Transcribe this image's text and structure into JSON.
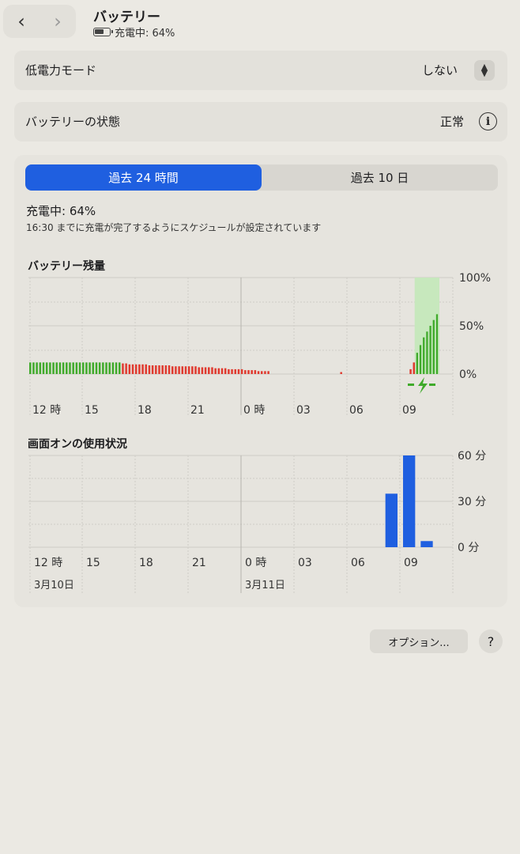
{
  "header": {
    "back_icon": "chevron-left-icon",
    "forward_icon": "chevron-right-icon",
    "title": "バッテリー",
    "subtitle": "充電中: 64%"
  },
  "low_power": {
    "label": "低電力モード",
    "value": "しない"
  },
  "battery_health": {
    "label": "バッテリーの状態",
    "value": "正常"
  },
  "tabs": [
    {
      "label": "過去 24 時間",
      "selected": true
    },
    {
      "label": "過去 10 日",
      "selected": false
    }
  ],
  "charge": {
    "status": "充電中: 64%",
    "schedule": "16:30 までに充電が完了するようにスケジュールが設定されています"
  },
  "battery_chart_title": "バッテリー残量",
  "screen_chart_title": "画面オンの使用状況",
  "x_ticks": [
    "12 時",
    "15",
    "18",
    "21",
    "0 時",
    "03",
    "06",
    "09"
  ],
  "date_labels": [
    "3月10日",
    "3月11日"
  ],
  "buttons": {
    "options": "オプション...",
    "help": "?"
  },
  "colors": {
    "accent": "#1f5fe0",
    "battery_green": "#3faa2a",
    "battery_red": "#e03a2f",
    "usage_blue": "#1f5fe0",
    "charging_band": "#c7e8bd"
  },
  "chart_data": [
    {
      "type": "bar",
      "title": "バッテリー残量",
      "xlabel": "",
      "ylabel": "",
      "y_ticks": [
        "100%",
        "50%",
        "0%"
      ],
      "ylim": [
        0,
        100
      ],
      "x_ticks": [
        "12 時",
        "15",
        "18",
        "21",
        "0 時",
        "03",
        "06",
        "09"
      ],
      "series": [
        {
          "values": [
            12,
            12,
            12,
            12,
            12,
            12,
            12,
            12,
            12,
            12,
            12,
            12,
            12,
            12,
            12,
            12,
            12,
            12,
            12,
            12,
            12,
            12,
            12,
            12,
            12,
            12,
            12,
            12,
            11,
            11,
            10,
            10,
            10,
            10,
            10,
            10,
            9,
            9,
            9,
            9,
            9,
            9,
            9,
            8,
            8,
            8,
            8,
            8,
            8,
            8,
            8,
            7,
            7,
            7,
            7,
            7,
            6,
            6,
            6,
            6,
            5,
            5,
            5,
            5,
            5,
            4,
            4,
            4,
            4,
            3,
            3,
            3,
            3,
            0,
            0,
            0,
            0,
            0,
            0,
            0,
            0,
            0,
            0,
            0,
            0,
            0,
            0,
            0,
            0,
            0,
            0,
            0,
            0,
            0,
            2,
            0,
            0,
            0,
            0,
            0,
            0,
            0,
            0,
            0,
            0,
            0,
            0,
            0,
            0,
            0,
            0,
            0,
            0,
            0,
            0,
            5,
            12,
            22,
            30,
            38,
            44,
            50,
            56,
            62
          ],
          "colors": [
            "green",
            "green",
            "green",
            "green",
            "green",
            "green",
            "green",
            "green",
            "green",
            "green",
            "green",
            "green",
            "green",
            "green",
            "green",
            "green",
            "green",
            "green",
            "green",
            "green",
            "green",
            "green",
            "green",
            "green",
            "green",
            "green",
            "green",
            "green",
            "red",
            "red",
            "red",
            "red",
            "red",
            "red",
            "red",
            "red",
            "red",
            "red",
            "red",
            "red",
            "red",
            "red",
            "red",
            "red",
            "red",
            "red",
            "red",
            "red",
            "red",
            "red",
            "red",
            "red",
            "red",
            "red",
            "red",
            "red",
            "red",
            "red",
            "red",
            "red",
            "red",
            "red",
            "red",
            "red",
            "red",
            "red",
            "red",
            "red",
            "red",
            "red",
            "red",
            "red",
            "red",
            "none",
            "none",
            "none",
            "none",
            "none",
            "none",
            "none",
            "none",
            "none",
            "none",
            "none",
            "none",
            "none",
            "none",
            "none",
            "none",
            "none",
            "none",
            "none",
            "none",
            "none",
            "red",
            "none",
            "none",
            "none",
            "none",
            "none",
            "none",
            "none",
            "none",
            "none",
            "none",
            "none",
            "none",
            "none",
            "none",
            "none",
            "none",
            "none",
            "none",
            "none",
            "none",
            "red",
            "red",
            "green",
            "green",
            "green",
            "green",
            "green",
            "green",
            "green"
          ]
        }
      ],
      "charging_period_start_index": 117,
      "grid": true
    },
    {
      "type": "bar",
      "title": "画面オンの使用状況",
      "xlabel": "",
      "ylabel": "",
      "y_ticks": [
        "60 分",
        "30 分",
        "0 分"
      ],
      "ylim": [
        0,
        60
      ],
      "x_ticks": [
        "12 時",
        "15",
        "18",
        "21",
        "0 時",
        "03",
        "06",
        "09"
      ],
      "x_sub_labels": [
        "3月10日",
        "",
        "",
        "",
        "3月11日",
        "",
        "",
        ""
      ],
      "series": [
        {
          "hours": [
            "08",
            "09",
            "10"
          ],
          "values": [
            35,
            60,
            4
          ]
        }
      ],
      "grid": true
    }
  ]
}
